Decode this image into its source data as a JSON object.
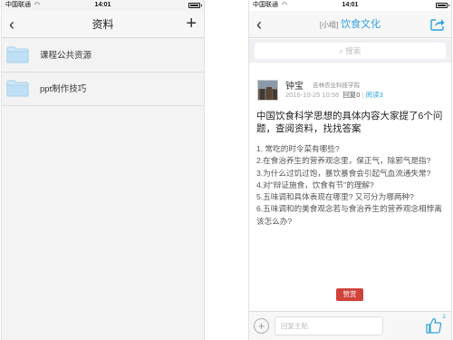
{
  "status": {
    "carrier": "中国联通",
    "time": "14:01"
  },
  "left": {
    "title": "资料",
    "files": [
      {
        "name": "课程公共资源"
      },
      {
        "name": "ppt制作技巧"
      }
    ]
  },
  "right": {
    "group_tag": "[小组]",
    "group_name": "饮食文化",
    "search_placeholder": "搜索",
    "author": "钟宝",
    "school": "吉林农业科技学院",
    "date": "2016-10-25 10:58",
    "reply_count": "回复0",
    "read_count": "阅读3",
    "post_title": "中国饮食科学思想的具体内容大家提了6个问题，查阅资料，找找答案",
    "questions": [
      "1. 常吃的时令菜有哪些?",
      "2.在食治养生的营养观念里，保正气，除邪气是指?",
      "3.为什么过饥过饱，暴饮暴食会引起气血流通失常?",
      "4.对\"辩证施食，饮食有节\"的理解?",
      "5.五味调和具体表现在哪里? 又可分为哪两种?",
      "6.五味调和的美食观念若与食治养生的营养观念相悖离该怎么办?"
    ],
    "reward_label": "赞赏",
    "reply_placeholder": "回复主贴",
    "like_count": "2"
  },
  "colors": {
    "accent": "#2fa3dc",
    "reward": "#d0433b",
    "folder": "#bfe0f5"
  }
}
